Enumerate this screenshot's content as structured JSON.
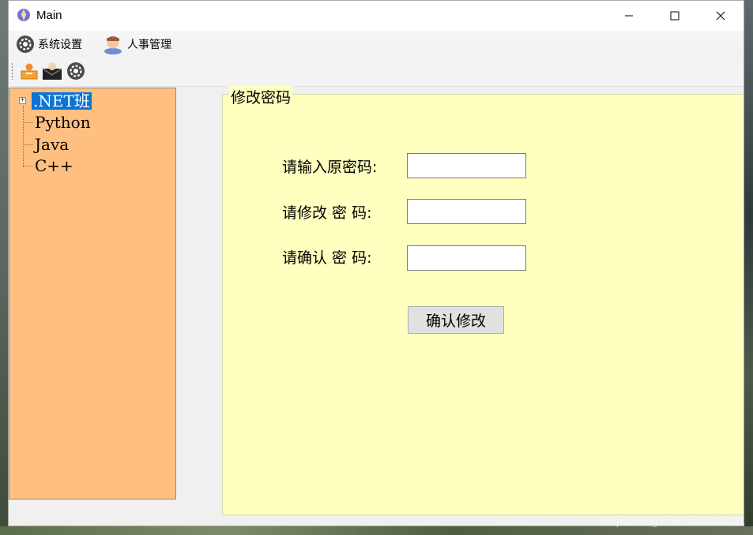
{
  "window": {
    "title": "Main"
  },
  "menubar": {
    "items": [
      {
        "label": "系统设置",
        "icon": "gear-icon"
      },
      {
        "label": "人事管理",
        "icon": "person-icon"
      }
    ]
  },
  "toolbar": {
    "buttons": [
      {
        "icon": "user-folder-icon"
      },
      {
        "icon": "envelope-user-icon"
      },
      {
        "icon": "gear-icon"
      }
    ]
  },
  "tree": {
    "nodes": [
      {
        "label": ".NET班",
        "selected": true,
        "expandable": true,
        "expander": "+"
      },
      {
        "label": "Python",
        "selected": false
      },
      {
        "label": "Java",
        "selected": false
      },
      {
        "label": "C++",
        "selected": false
      }
    ]
  },
  "form": {
    "group_title": "修改密码",
    "old_password_label": "请输入原密码:",
    "new_password_label": "请修改 密 码:",
    "confirm_password_label": "请确认 密 码:",
    "old_password_value": "",
    "new_password_value": "",
    "confirm_password_value": "",
    "submit_label": "确认修改"
  },
  "watermark": "https://blog.csdn.net/JCD311",
  "colors": {
    "tree_bg": "#ffbf80",
    "panel_bg": "#ffffc0",
    "selection": "#0a74d6"
  }
}
